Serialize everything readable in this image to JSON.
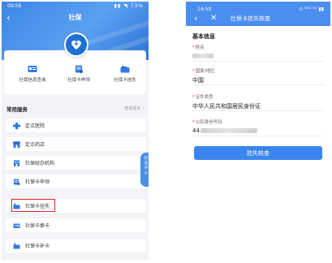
{
  "left": {
    "status_time": "09:56",
    "status_right": "▮▮ ◥ 73%",
    "title": "社保",
    "services": [
      {
        "label": "社保信息查询"
      },
      {
        "label": "社保卡申领"
      },
      {
        "label": "社保卡挂失"
      }
    ],
    "section_title": "常用服务",
    "section_more": "查看更多 ›",
    "items": [
      {
        "label": "定点医院"
      },
      {
        "label": "定点药店"
      },
      {
        "label": "社保经办机构"
      },
      {
        "label": "社保卡申领"
      },
      {
        "label": "社保卡挂失"
      },
      {
        "label": "社保卡换卡"
      },
      {
        "label": "社保卡补卡"
      }
    ],
    "float_button": "好\n差\n评\n◎"
  },
  "right": {
    "status_time": "14:50",
    "status_right": "⊙ ⁸ᴴᴰ ⁵ᴳ ▮▮",
    "title": "社保卡挂失核查",
    "section_title": "基本信息",
    "fields": [
      {
        "label": "姓名",
        "value": ""
      },
      {
        "label": "国家/地区",
        "value": "中国"
      },
      {
        "label": "证件类型",
        "value": "中华人民共和国居民身份证"
      },
      {
        "label": "公民身份号码",
        "value": "44"
      }
    ],
    "submit_label": "挂失核查"
  },
  "colors": {
    "primary": "#3b86ee",
    "highlight": "#e02424"
  }
}
